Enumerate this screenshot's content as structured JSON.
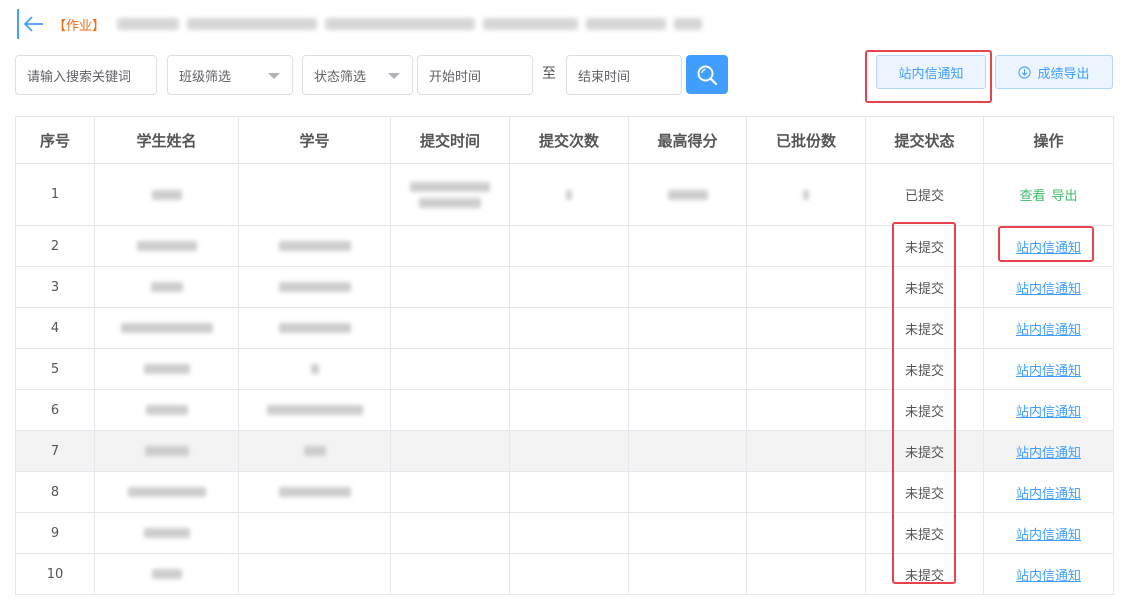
{
  "header": {
    "tag": "【作业】"
  },
  "filters": {
    "search_placeholder": "请输入搜索关键词",
    "class_filter": "班级筛选",
    "status_filter": "状态筛选",
    "start_time": "开始时间",
    "to_label": "至",
    "end_time": "结束时间"
  },
  "actions": {
    "notify_label": "站内信通知",
    "export_label": "成绩导出"
  },
  "table": {
    "columns": [
      "序号",
      "学生姓名",
      "学号",
      "提交时间",
      "提交次数",
      "最高得分",
      "已批份数",
      "提交状态",
      "操作"
    ],
    "rows": [
      {
        "index": "1",
        "status": "已提交",
        "op_view": "查看",
        "op_export": "导出"
      },
      {
        "index": "2",
        "status": "未提交",
        "op_notify": "站内信通知"
      },
      {
        "index": "3",
        "status": "未提交",
        "op_notify": "站内信通知"
      },
      {
        "index": "4",
        "status": "未提交",
        "op_notify": "站内信通知"
      },
      {
        "index": "5",
        "status": "未提交",
        "op_notify": "站内信通知"
      },
      {
        "index": "6",
        "status": "未提交",
        "op_notify": "站内信通知"
      },
      {
        "index": "7",
        "status": "未提交",
        "op_notify": "站内信通知"
      },
      {
        "index": "8",
        "status": "未提交",
        "op_notify": "站内信通知"
      },
      {
        "index": "9",
        "status": "未提交",
        "op_notify": "站内信通知"
      },
      {
        "index": "10",
        "status": "未提交",
        "op_notify": "站内信通知"
      }
    ]
  },
  "colors": {
    "primary": "#409eff",
    "tag_orange": "#f56c16",
    "highlight_red": "#e8424e",
    "link_green": "#3cbc6a"
  }
}
